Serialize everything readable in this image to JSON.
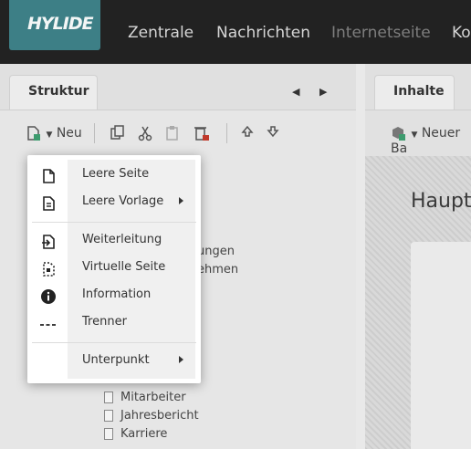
{
  "header": {
    "logo_text": "HYLIDE",
    "nav": [
      "Zentrale",
      "Nachrichten",
      "Internetseite",
      "Ko"
    ]
  },
  "left_panel": {
    "tab_label": "Struktur",
    "toolbar": {
      "new_label": "Neu"
    },
    "tree": {
      "partial_items": [
        "ungen",
        "ehmen"
      ],
      "items": [
        "Mitarbeiter",
        "Jahresbericht",
        "Karriere"
      ]
    }
  },
  "right_panel": {
    "tab_label": "Inhalte",
    "toolbar": {
      "new_block_label": "Neuer Ba"
    },
    "heading": "Haupt"
  },
  "context_menu": {
    "items": [
      {
        "label": "Leere Seite",
        "icon": "file-icon"
      },
      {
        "label": "Leere Vorlage",
        "icon": "template-file-icon",
        "submenu": true
      },
      {
        "label": "Weiterleitung",
        "icon": "redirect-file-icon"
      },
      {
        "label": "Virtuelle Seite",
        "icon": "virtual-page-icon"
      },
      {
        "label": "Information",
        "icon": "info-icon"
      },
      {
        "label": "Trenner",
        "icon": "separator-dashes-icon"
      },
      {
        "label": "Unterpunkt",
        "submenu": true
      }
    ]
  },
  "colors": {
    "topbar": "#222222",
    "logo_bg": "#3d7f86",
    "nav_active": "#d6d6d6",
    "nav_dim": "#7e7e7e"
  }
}
